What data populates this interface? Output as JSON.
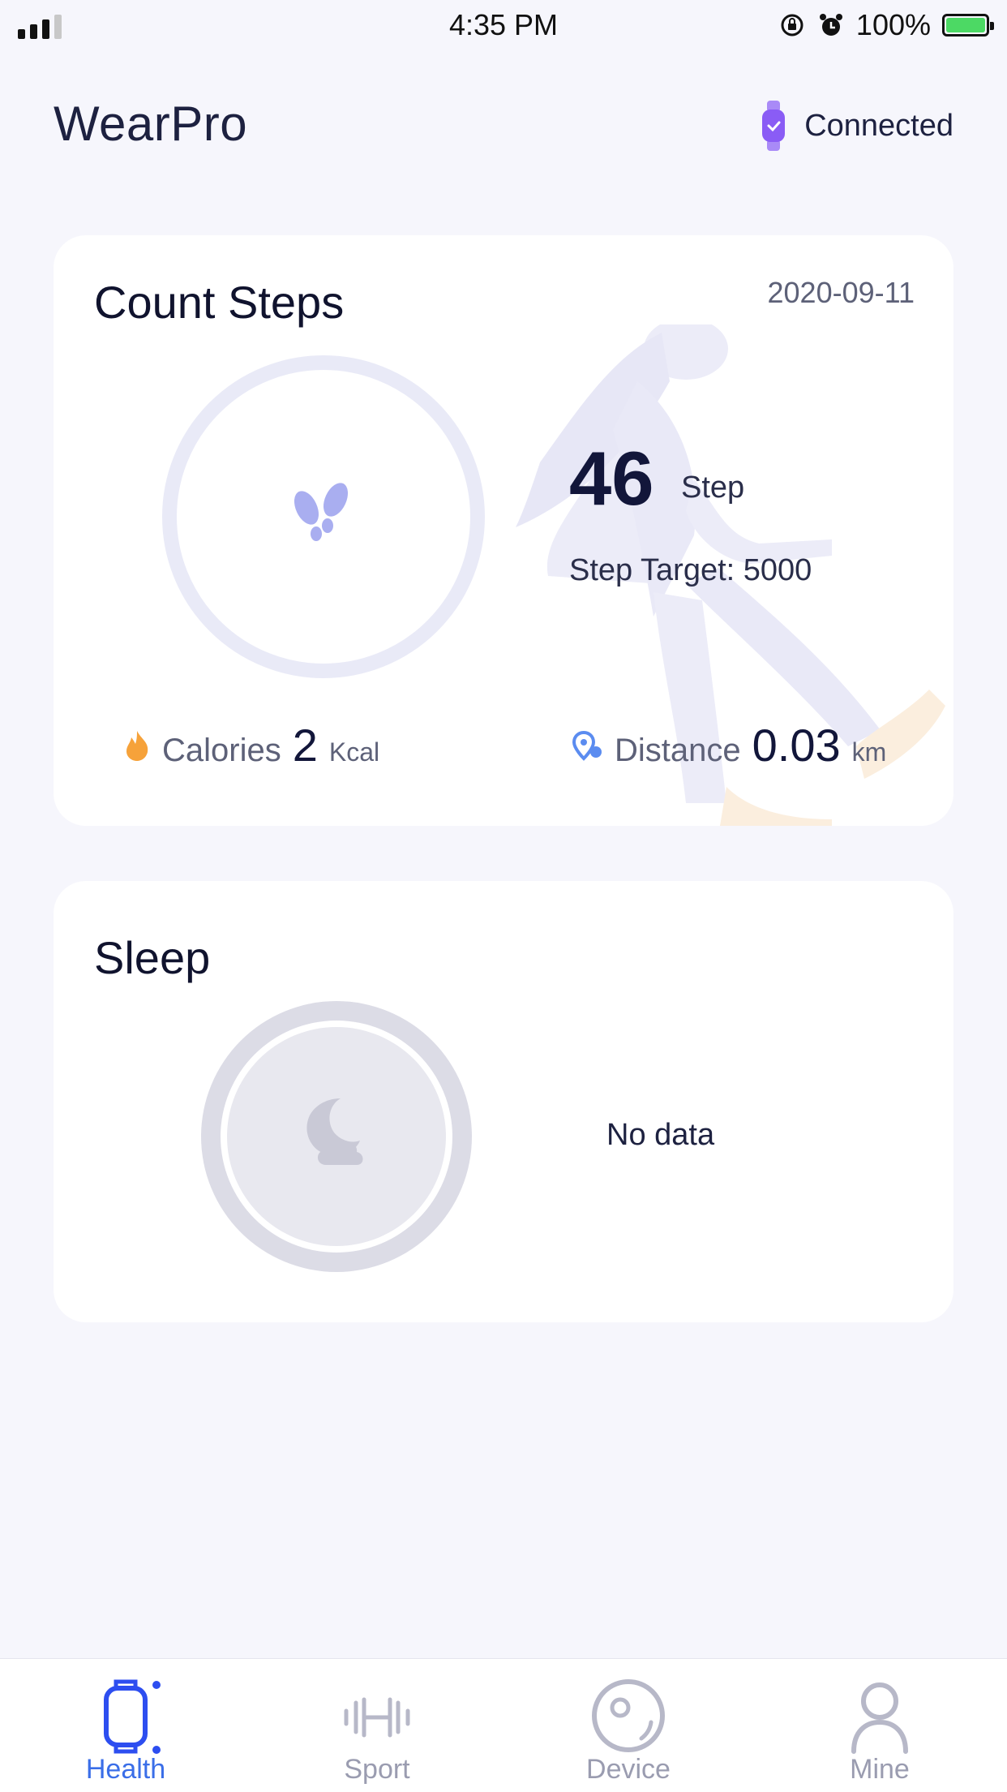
{
  "status_bar": {
    "time": "4:35 PM",
    "battery": "100%",
    "icons": [
      "signal-icon",
      "orientation-lock-icon",
      "alarm-icon",
      "battery-icon"
    ]
  },
  "header": {
    "title": "WearPro",
    "connection_status": "Connected",
    "watch_icon": "watch-icon"
  },
  "steps_card": {
    "title": "Count Steps",
    "date": "2020-09-11",
    "steps": "46",
    "steps_unit": "Step",
    "target": "Step Target: 5000",
    "calories_label": "Calories",
    "calories_value": "2",
    "calories_unit": "Kcal",
    "distance_label": "Distance",
    "distance_value": "0.03",
    "distance_unit": "km",
    "icons": [
      "footprints-icon",
      "flame-icon",
      "location-pin-icon"
    ]
  },
  "sleep_card": {
    "title": "Sleep",
    "status": "No data",
    "icon": "moon-cloud-icon"
  },
  "tabs": [
    {
      "label": "Health",
      "icon": "watch-icon",
      "active": true
    },
    {
      "label": "Sport",
      "icon": "dumbbell-icon",
      "active": false
    },
    {
      "label": "Device",
      "icon": "device-icon",
      "active": false
    },
    {
      "label": "Mine",
      "icon": "person-icon",
      "active": false
    }
  ],
  "colors": {
    "background": "#f6f6fc",
    "accent": "#3a6ee8",
    "watch_purple": "#8a5cf5",
    "flame_orange": "#f6a23a",
    "inactive_tab": "#9a9cb0"
  }
}
